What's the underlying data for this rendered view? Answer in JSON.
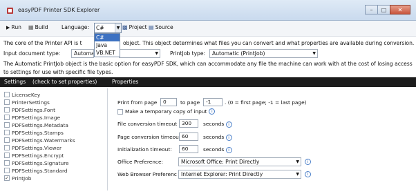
{
  "window": {
    "title": "easyPDF Printer SDK Explorer"
  },
  "toolbar": {
    "run_label": "Run",
    "build_label": "Build",
    "language_label": "Language:",
    "language_value": "C#",
    "project_label": "Project",
    "source_label": "Source"
  },
  "language_dropdown": {
    "options": [
      "C#",
      "Java",
      "VB.NET"
    ]
  },
  "description": {
    "line1_start": "The core of the Printer API is t",
    "line1_end": "object. This object determines what files you can convert and what properties are available during conversion.",
    "line2": "The Automatic PrintJob object is the basic option for easyPDF SDK, which can accommodate any file the machine can work with at the cost of losing access",
    "line3": "to settings for use with specific file types."
  },
  "input_doc": {
    "label": "Input document type:",
    "value": "Automa"
  },
  "printjob_type": {
    "label": "PrintJob type:",
    "value": "Automatic (PrintJob)"
  },
  "tabs": {
    "settings": "Settings",
    "check_hint": "(check to set properties)",
    "properties": "Properties"
  },
  "settings_list": [
    {
      "label": "LicenseKey",
      "checked": false
    },
    {
      "label": "PrinterSettings",
      "checked": false
    },
    {
      "label": "PDFSettings.Font",
      "checked": false
    },
    {
      "label": "PDFSettings.Image",
      "checked": false
    },
    {
      "label": "PDFSettings.Metadata",
      "checked": false
    },
    {
      "label": "PDFSettings.Stamps",
      "checked": false
    },
    {
      "label": "PDFSettings.Watermarks",
      "checked": false
    },
    {
      "label": "PDFSettings.Viewer",
      "checked": false
    },
    {
      "label": "PDFSettings.Encrypt",
      "checked": false
    },
    {
      "label": "PDFSettings.Signature",
      "checked": false
    },
    {
      "label": "PDFSettings.Standard",
      "checked": false
    },
    {
      "label": "PrintJob",
      "checked": true
    }
  ],
  "properties": {
    "print_from_label": "Print from page",
    "print_from_value": "0",
    "to_page_label": "to page",
    "to_page_value": "-1",
    "page_hint": ". (0 = first page; -1 = last page)",
    "temp_copy_label": "Make a temporary copy of input",
    "file_timeout_label": "File conversion timeout",
    "file_timeout_value": "300",
    "page_timeout_label": "Page conversion timeou",
    "page_timeout_value": "60",
    "init_timeout_label": "Initialization timeout:",
    "init_timeout_value": "60",
    "seconds_label": "seconds",
    "office_label": "Office Preference:",
    "office_value": "Microsoft Office: Print Directly",
    "browser_label": "Web Browser Preferenc",
    "browser_value": "Internet Explorer: Print Directly"
  },
  "icons": [
    "app-icon",
    "run-icon",
    "build-icon",
    "project-icon",
    "source-icon",
    "info-icon",
    "minimize-icon",
    "maximize-icon",
    "close-icon"
  ]
}
